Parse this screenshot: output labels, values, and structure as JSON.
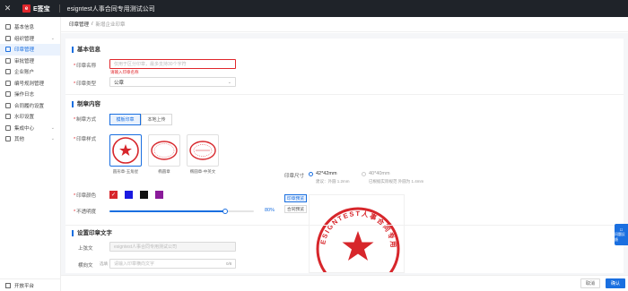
{
  "topbar": {
    "close": "✕",
    "logo_mark": "e",
    "logo_name": "E签宝",
    "title": "esigntest人事合同专用测试公司"
  },
  "sidebar": {
    "items": [
      {
        "label": "基本信息",
        "active": false,
        "chev": ""
      },
      {
        "label": "组织管理",
        "active": false,
        "chev": "⌄"
      },
      {
        "label": "印章管理",
        "active": true,
        "chev": ""
      },
      {
        "label": "审批管理",
        "active": false,
        "chev": ""
      },
      {
        "label": "企业账户",
        "active": false,
        "chev": ""
      },
      {
        "label": "编号规则管理",
        "active": false,
        "chev": ""
      },
      {
        "label": "操作日志",
        "active": false,
        "chev": ""
      },
      {
        "label": "合同履约设置",
        "active": false,
        "chev": ""
      },
      {
        "label": "水印设置",
        "active": false,
        "chev": ""
      },
      {
        "label": "集成中心",
        "active": false,
        "chev": "⌄"
      },
      {
        "label": "其他",
        "active": false,
        "chev": "⌄"
      }
    ],
    "bottom": "开放平台"
  },
  "breadcrumb": {
    "parent": "印章管理",
    "sep": "/",
    "current": "新增企业印章"
  },
  "basic": {
    "title": "基本信息",
    "name_label": "印章名称",
    "name_placeholder": "仅用于区分印章，最多支持30个字符",
    "name_error": "请输入印章名称",
    "type_label": "印章类型",
    "type_value": "公章"
  },
  "make": {
    "title": "制章内容",
    "method_label": "制章方式",
    "method_options": [
      "模板印章",
      "本地上传"
    ],
    "style_label": "印章样式",
    "styles": [
      "圆形章-五角星",
      "椭圆章",
      "椭圆章-中英文"
    ],
    "color_label": "印章颜色",
    "colors": [
      "#d7262b",
      "#1a1ae0",
      "#111111",
      "#8a1a9a"
    ],
    "opacity_label": "不透明度",
    "opacity_value": "80%",
    "opacity_percent": 80,
    "size_label": "印章尺寸",
    "size_options": [
      {
        "label": "42*42mm",
        "sub": "建议：外圆 1.2mm",
        "on": true
      },
      {
        "label": "40*40mm",
        "sub": "已根据实际规范 外圆为 1.4mm",
        "on": false
      }
    ],
    "preview_tabs": [
      "印章预览",
      "合同预览"
    ],
    "seal_text": "ESIGNTEST人事合同专用测试公司"
  },
  "text": {
    "title": "设置印章文字",
    "upper_label": "上弦文",
    "upper_value": "esigntest人事合同专用测试公司",
    "lower_label": "横向文",
    "lower_hint": "选填",
    "lower_placeholder": "请输入印章横向文字",
    "lower_count": "0/8"
  },
  "footer": {
    "cancel": "取消",
    "ok": "确认"
  },
  "float_help": "问题反馈"
}
